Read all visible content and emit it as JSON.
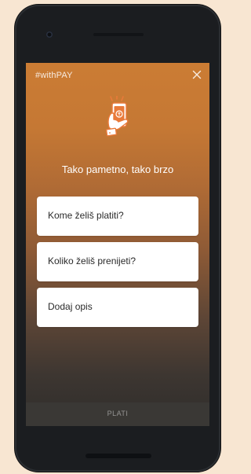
{
  "app": {
    "title": "#withPAY",
    "close_icon": "close-icon"
  },
  "hero": {
    "icon": "phone-in-hand-icon",
    "headline": "Tako pametno, tako brzo"
  },
  "form": {
    "fields": [
      {
        "label": "Kome želiš platiti?"
      },
      {
        "label": "Koliko želiš prenijeti?"
      },
      {
        "label": "Dodaj opis"
      }
    ]
  },
  "footer": {
    "pay_label": "PLATI"
  },
  "colors": {
    "page_bg": "#f8e6d2",
    "gradient_top": "#cb7c34",
    "gradient_bottom": "#2f2d2b",
    "accent": "#e97a3a"
  }
}
